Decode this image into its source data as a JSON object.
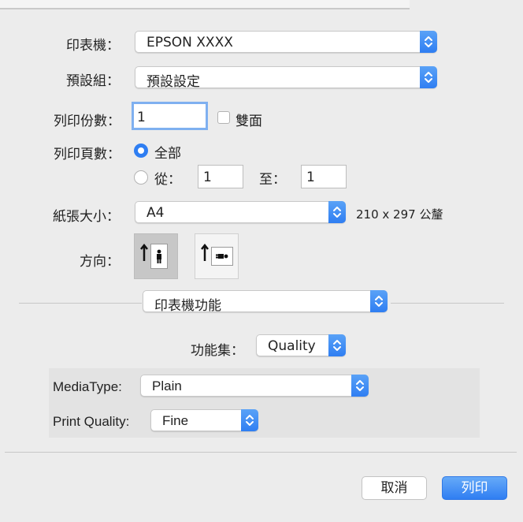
{
  "printer": {
    "label": "印表機：",
    "value": "EPSON XXXX"
  },
  "presets": {
    "label": "預設組：",
    "value": "預設設定"
  },
  "copies": {
    "label": "列印份數：",
    "value": "1",
    "duplex_label": "雙面"
  },
  "pages": {
    "label": "列印頁數：",
    "all_label": "全部",
    "from_label": "從：",
    "from_value": "1",
    "to_label": "至：",
    "to_value": "1"
  },
  "paper_size": {
    "label": "紙張大小：",
    "value": "A4",
    "dimensions": "210 x 297 公釐"
  },
  "orientation": {
    "label": "方向：",
    "selected": "portrait"
  },
  "section_menu": {
    "value": "印表機功能"
  },
  "feature_sets": {
    "label": "功能集：",
    "value": "Quality"
  },
  "media_type": {
    "label": "MediaType:",
    "value": "Plain"
  },
  "print_quality": {
    "label": "Print Quality:",
    "value": "Fine"
  },
  "buttons": {
    "cancel": "取消",
    "print": "列印"
  },
  "colors": {
    "accent": "#2f7ef2",
    "background": "#ececec"
  }
}
